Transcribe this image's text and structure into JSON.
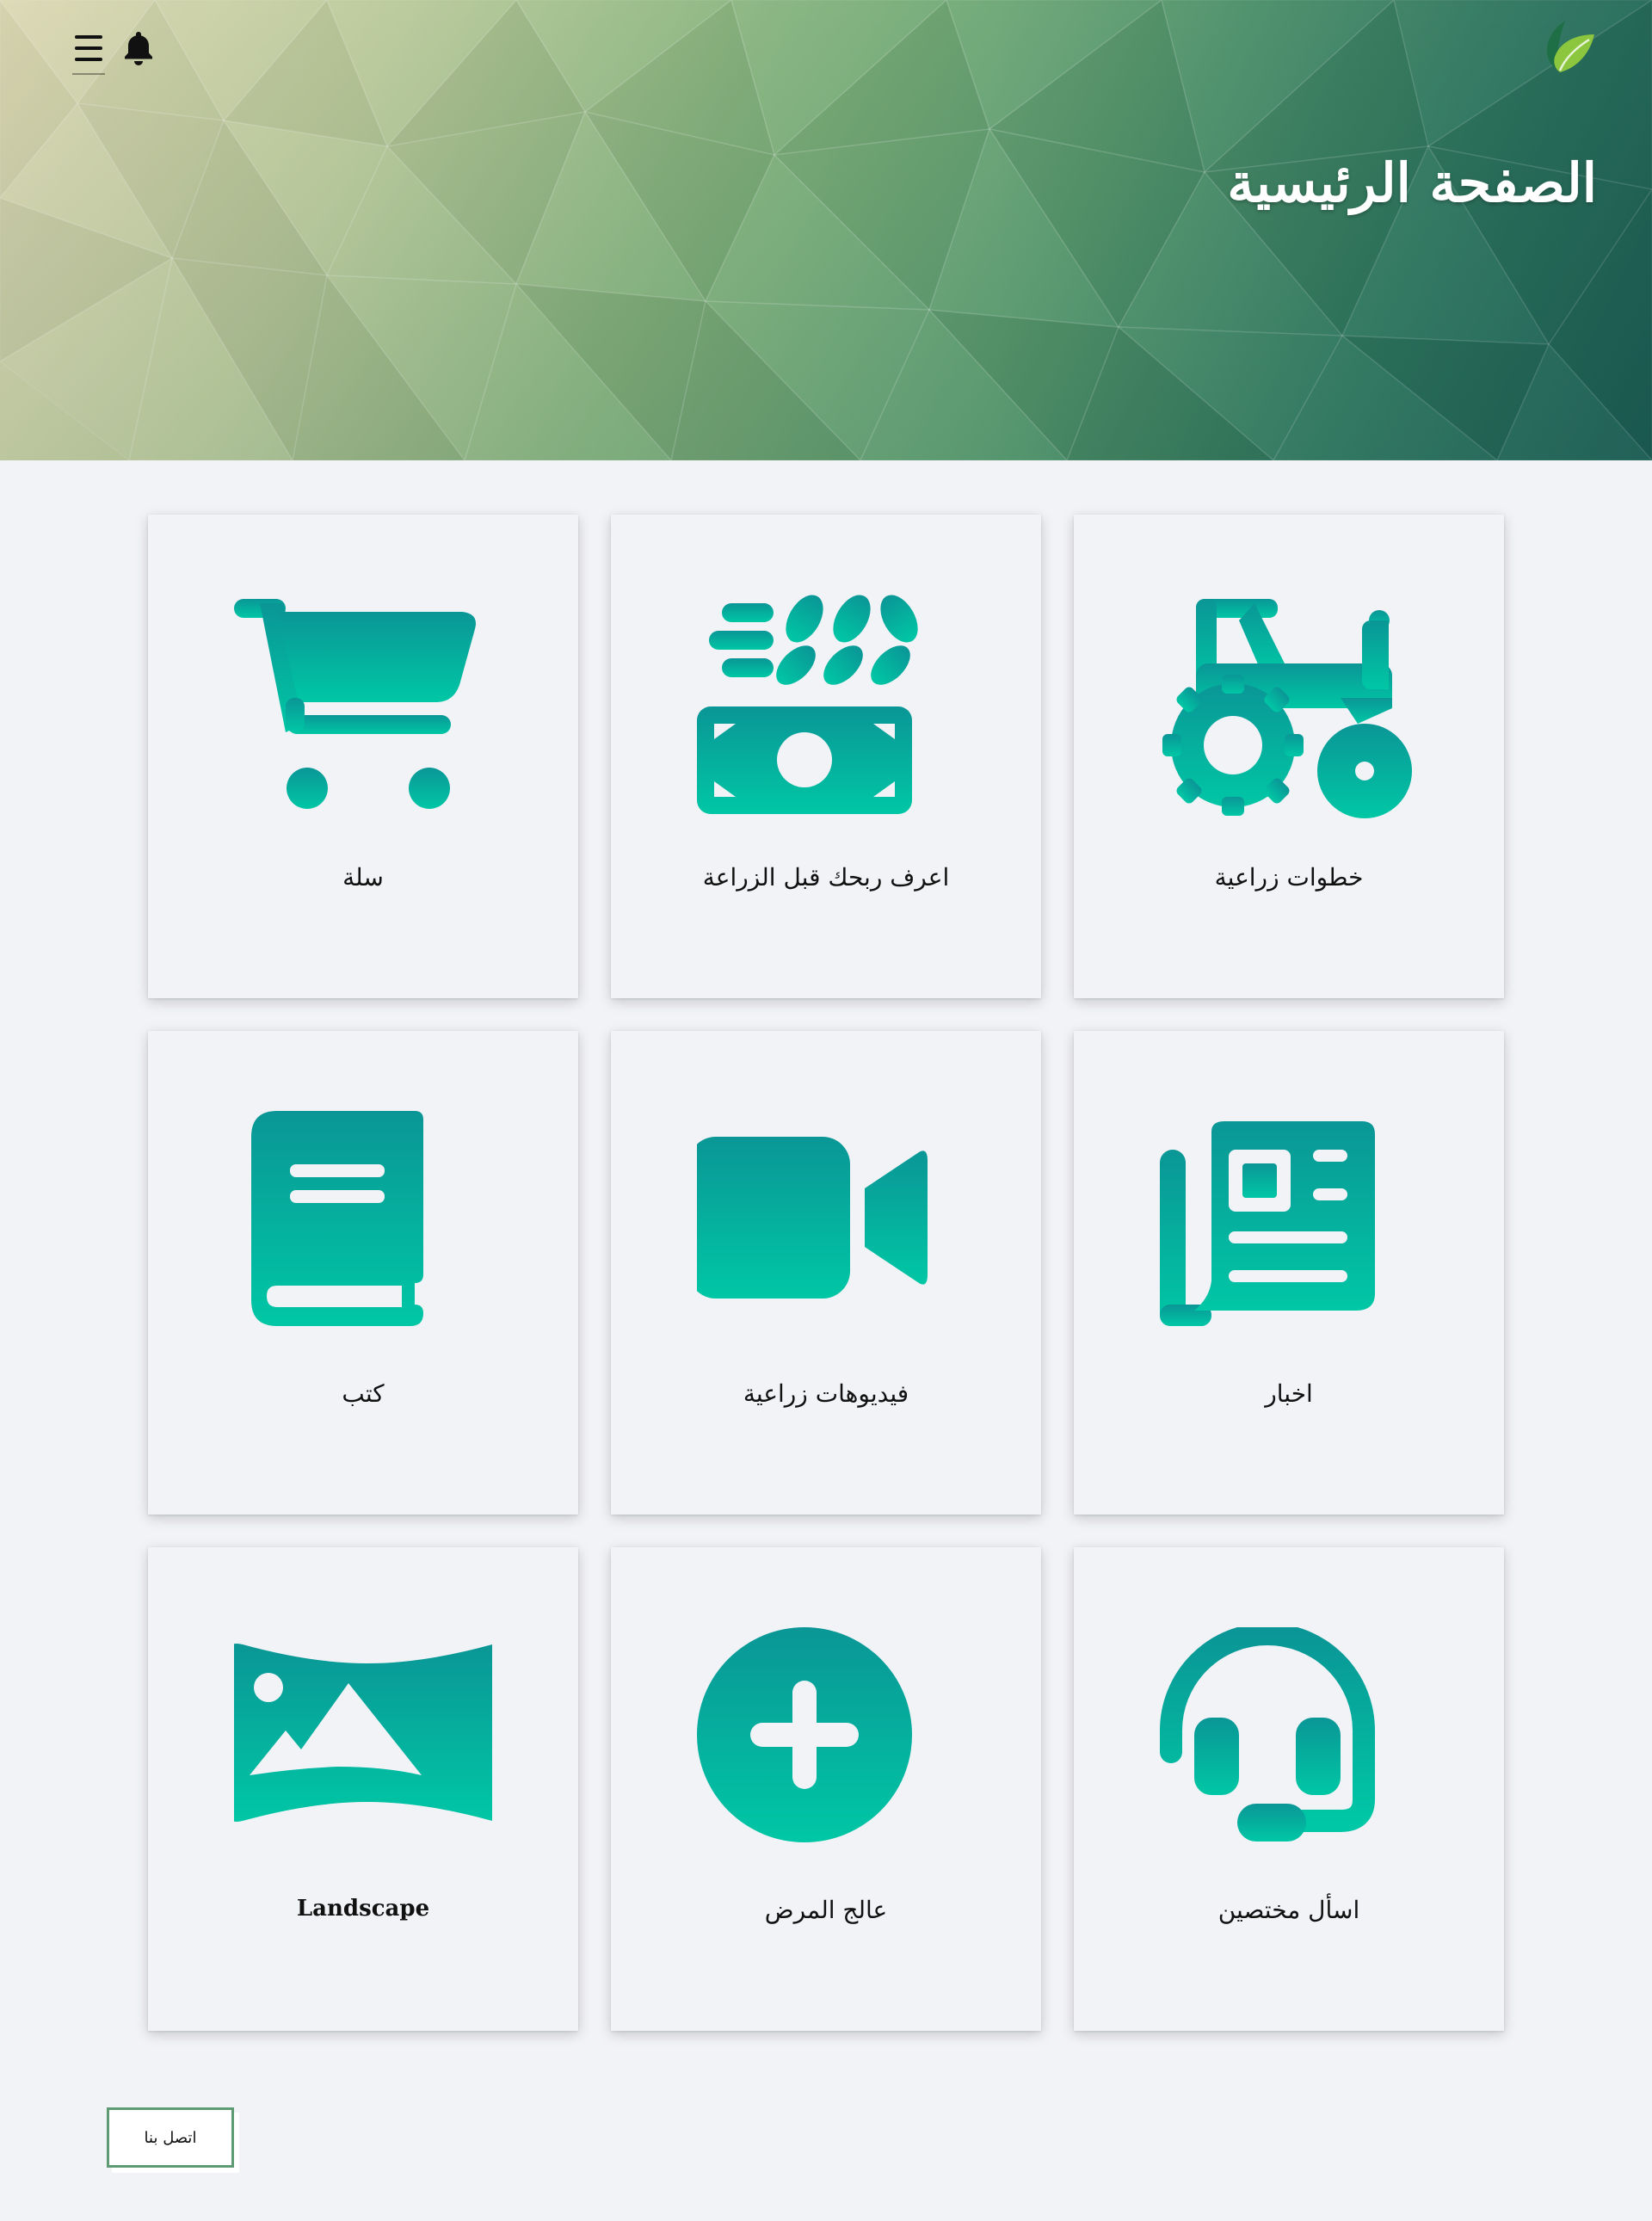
{
  "header": {
    "title": "الصفحة الرئيسية",
    "menu_icon": "hamburger-menu-icon",
    "notification_icon": "bell-icon",
    "logo_icon": "leaf-logo-icon",
    "gradient_colors": [
      "#ddd9b4",
      "#86b47e",
      "#2f7f60",
      "#166453"
    ]
  },
  "cards": [
    {
      "label": "خطوات زراعية",
      "icon": "tractor-icon"
    },
    {
      "label": "اعرف ربحك قبل الزراعة",
      "icon": "money-wheat-icon"
    },
    {
      "label": "سلة",
      "icon": "cart-icon"
    },
    {
      "label": "اخبار",
      "icon": "newspaper-icon"
    },
    {
      "label": "فيديوهات زراعية",
      "icon": "video-camera-icon"
    },
    {
      "label": "كتب",
      "icon": "book-icon"
    },
    {
      "label": "اسأل مختصين",
      "icon": "headset-icon"
    },
    {
      "label": "عالج المرض",
      "icon": "plus-circle-icon"
    },
    {
      "label": "Landscape",
      "icon": "landscape-image-icon"
    }
  ],
  "icon_gradient": {
    "top": "#0a9696",
    "bottom": "#00c7a5"
  },
  "footer": {
    "contact_label": "اتصل بنا",
    "contact_border_color": "#5e9a72"
  }
}
